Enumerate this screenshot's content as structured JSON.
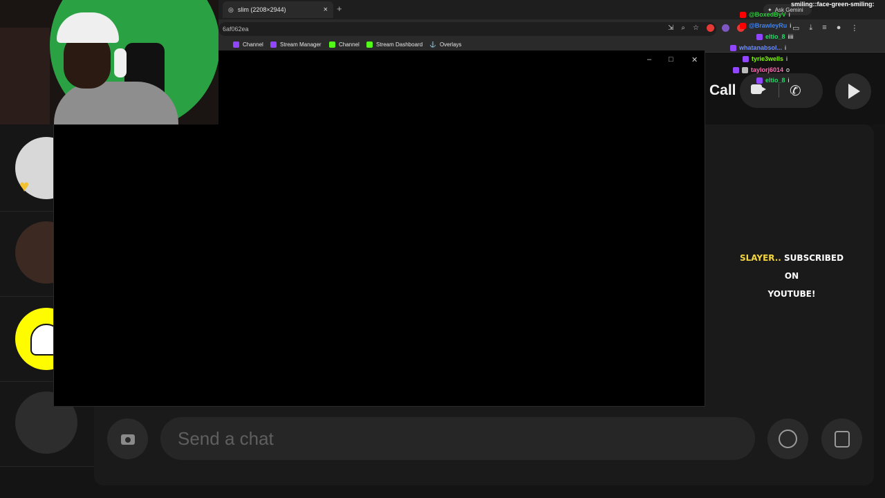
{
  "browser": {
    "tab_title": "slim (2208×2944)",
    "tab_close": "×",
    "new_tab": "+",
    "ask_gemini": "Ask Gemini",
    "address_fragment": "6af062ea",
    "bookmarks": [
      {
        "label": "Channel",
        "icon": "twitch-icon",
        "color": "#9146ff"
      },
      {
        "label": "Stream Manager",
        "icon": "twitch-icon",
        "color": "#9146ff"
      },
      {
        "label": "Channel",
        "icon": "kick-icon",
        "color": "#53fc18"
      },
      {
        "label": "Stream Dashboard",
        "icon": "kick-icon",
        "color": "#53fc18"
      },
      {
        "label": "Overlays",
        "icon": "anchor-icon",
        "color": "#e6e6e6"
      }
    ]
  },
  "popup_window": {
    "minimize": "–",
    "maximize": "□",
    "close": "✕"
  },
  "snapchat": {
    "call_label": "Call",
    "subscribe_highlight": "SLAYER..",
    "subscribe_line1_rest": " SUBSCRIBED ON",
    "subscribe_line2": "YOUTUBE!",
    "chat_placeholder": "Send a chat",
    "accent_yellow": "#fffc00"
  },
  "stream_chat": {
    "top_message": "smiling::face-green-smiling:",
    "lines": [
      {
        "user": "@BoxedByV",
        "msg": "i",
        "color": "#2ecc40",
        "platform": "youtube"
      },
      {
        "user": "@BrawleyRu",
        "msg": "i",
        "color": "#3b82f6",
        "platform": "youtube"
      },
      {
        "user": "eltio_8",
        "msg": "iiii",
        "color": "#22dd66",
        "platform": "twitch"
      },
      {
        "user": "whatanabsol...",
        "msg": "i",
        "color": "#6a8cff",
        "platform": "twitch"
      },
      {
        "user": "tyrie3wells",
        "msg": "i",
        "color": "#7cfc00",
        "platform": "twitch"
      },
      {
        "user": "taylorj6014",
        "msg": "o",
        "color": "#ff69b4",
        "platform": "twitch"
      },
      {
        "user": "eltio_8",
        "msg": "i",
        "color": "#22dd66",
        "platform": "twitch"
      }
    ]
  }
}
